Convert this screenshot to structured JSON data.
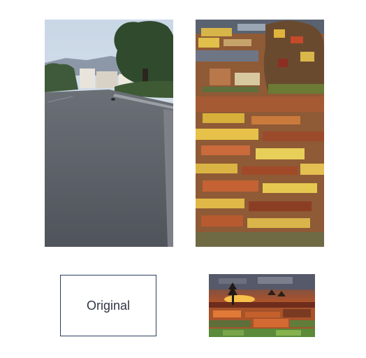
{
  "original_label": "Original",
  "images": {
    "original": {
      "description_icon": "street-photo-icon"
    },
    "stylized": {
      "description_icon": "painted-street-icon"
    },
    "style_reference": {
      "description_icon": "sunset-landscape-painting-icon"
    }
  },
  "colors": {
    "label_border": "#2b3f63",
    "label_text": "#2f3542"
  }
}
